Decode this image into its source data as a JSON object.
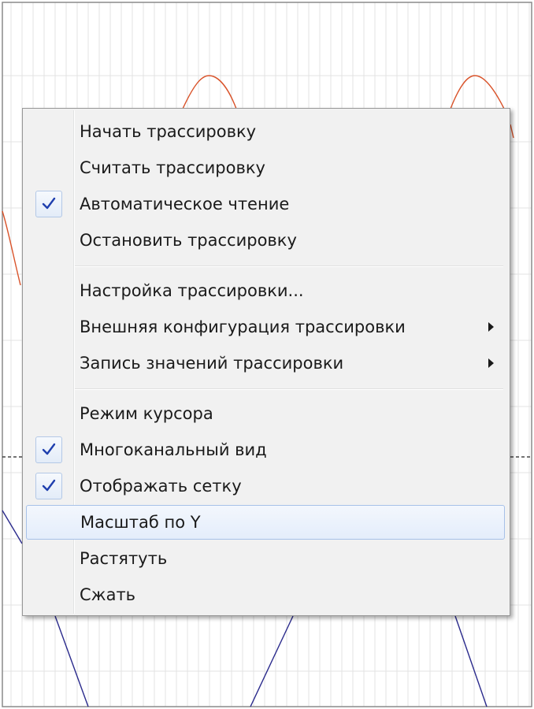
{
  "colors": {
    "grid": "#e3e3e3",
    "trace_red": "#d9532a",
    "trace_blue": "#2a2a8c",
    "check": "#1f3fae"
  },
  "menu": {
    "items": [
      {
        "label": "Начать трассировку",
        "checked": false,
        "submenu": false
      },
      {
        "label": "Считать трассировку",
        "checked": false,
        "submenu": false
      },
      {
        "label": "Автоматическое чтение",
        "checked": true,
        "submenu": false
      },
      {
        "label": "Остановить трассировку",
        "checked": false,
        "submenu": false
      },
      {
        "label": "Настройка трассировки...",
        "checked": false,
        "submenu": false
      },
      {
        "label": "Внешняя конфигурация трассировки",
        "checked": false,
        "submenu": true
      },
      {
        "label": "Запись значений трассировки",
        "checked": false,
        "submenu": true
      },
      {
        "label": "Режим курсора",
        "checked": false,
        "submenu": false
      },
      {
        "label": "Многоканальный вид",
        "checked": true,
        "submenu": false
      },
      {
        "label": "Отображать сетку",
        "checked": true,
        "submenu": false
      },
      {
        "label": "Масштаб по Y",
        "checked": false,
        "submenu": false,
        "highlighted": true
      },
      {
        "label": "Растятуть",
        "checked": false,
        "submenu": false
      },
      {
        "label": "Сжать",
        "checked": false,
        "submenu": false
      }
    ]
  }
}
